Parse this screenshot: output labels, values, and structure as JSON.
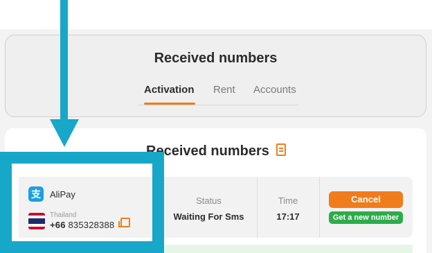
{
  "header": {
    "title": "Received numbers",
    "tabs": [
      {
        "label": "Activation",
        "active": true
      },
      {
        "label": "Rent",
        "active": false
      },
      {
        "label": "Accounts",
        "active": false
      }
    ]
  },
  "section": {
    "title": "Received numbers",
    "icon": "document-icon"
  },
  "order": {
    "service": "AliPay",
    "service_icon": "alipay-icon",
    "country": "Thailand",
    "country_code": "+66",
    "number": "835328388",
    "status_label": "Status",
    "status_value": "Waiting For Sms",
    "time_label": "Time",
    "time_value": "17:17",
    "cancel_label": "Cancel",
    "new_number_label": "Get a new number"
  },
  "colors": {
    "accent_orange": "#f07c1c",
    "success_green": "#2eab4a",
    "highlight_blue": "#17a7c9"
  }
}
